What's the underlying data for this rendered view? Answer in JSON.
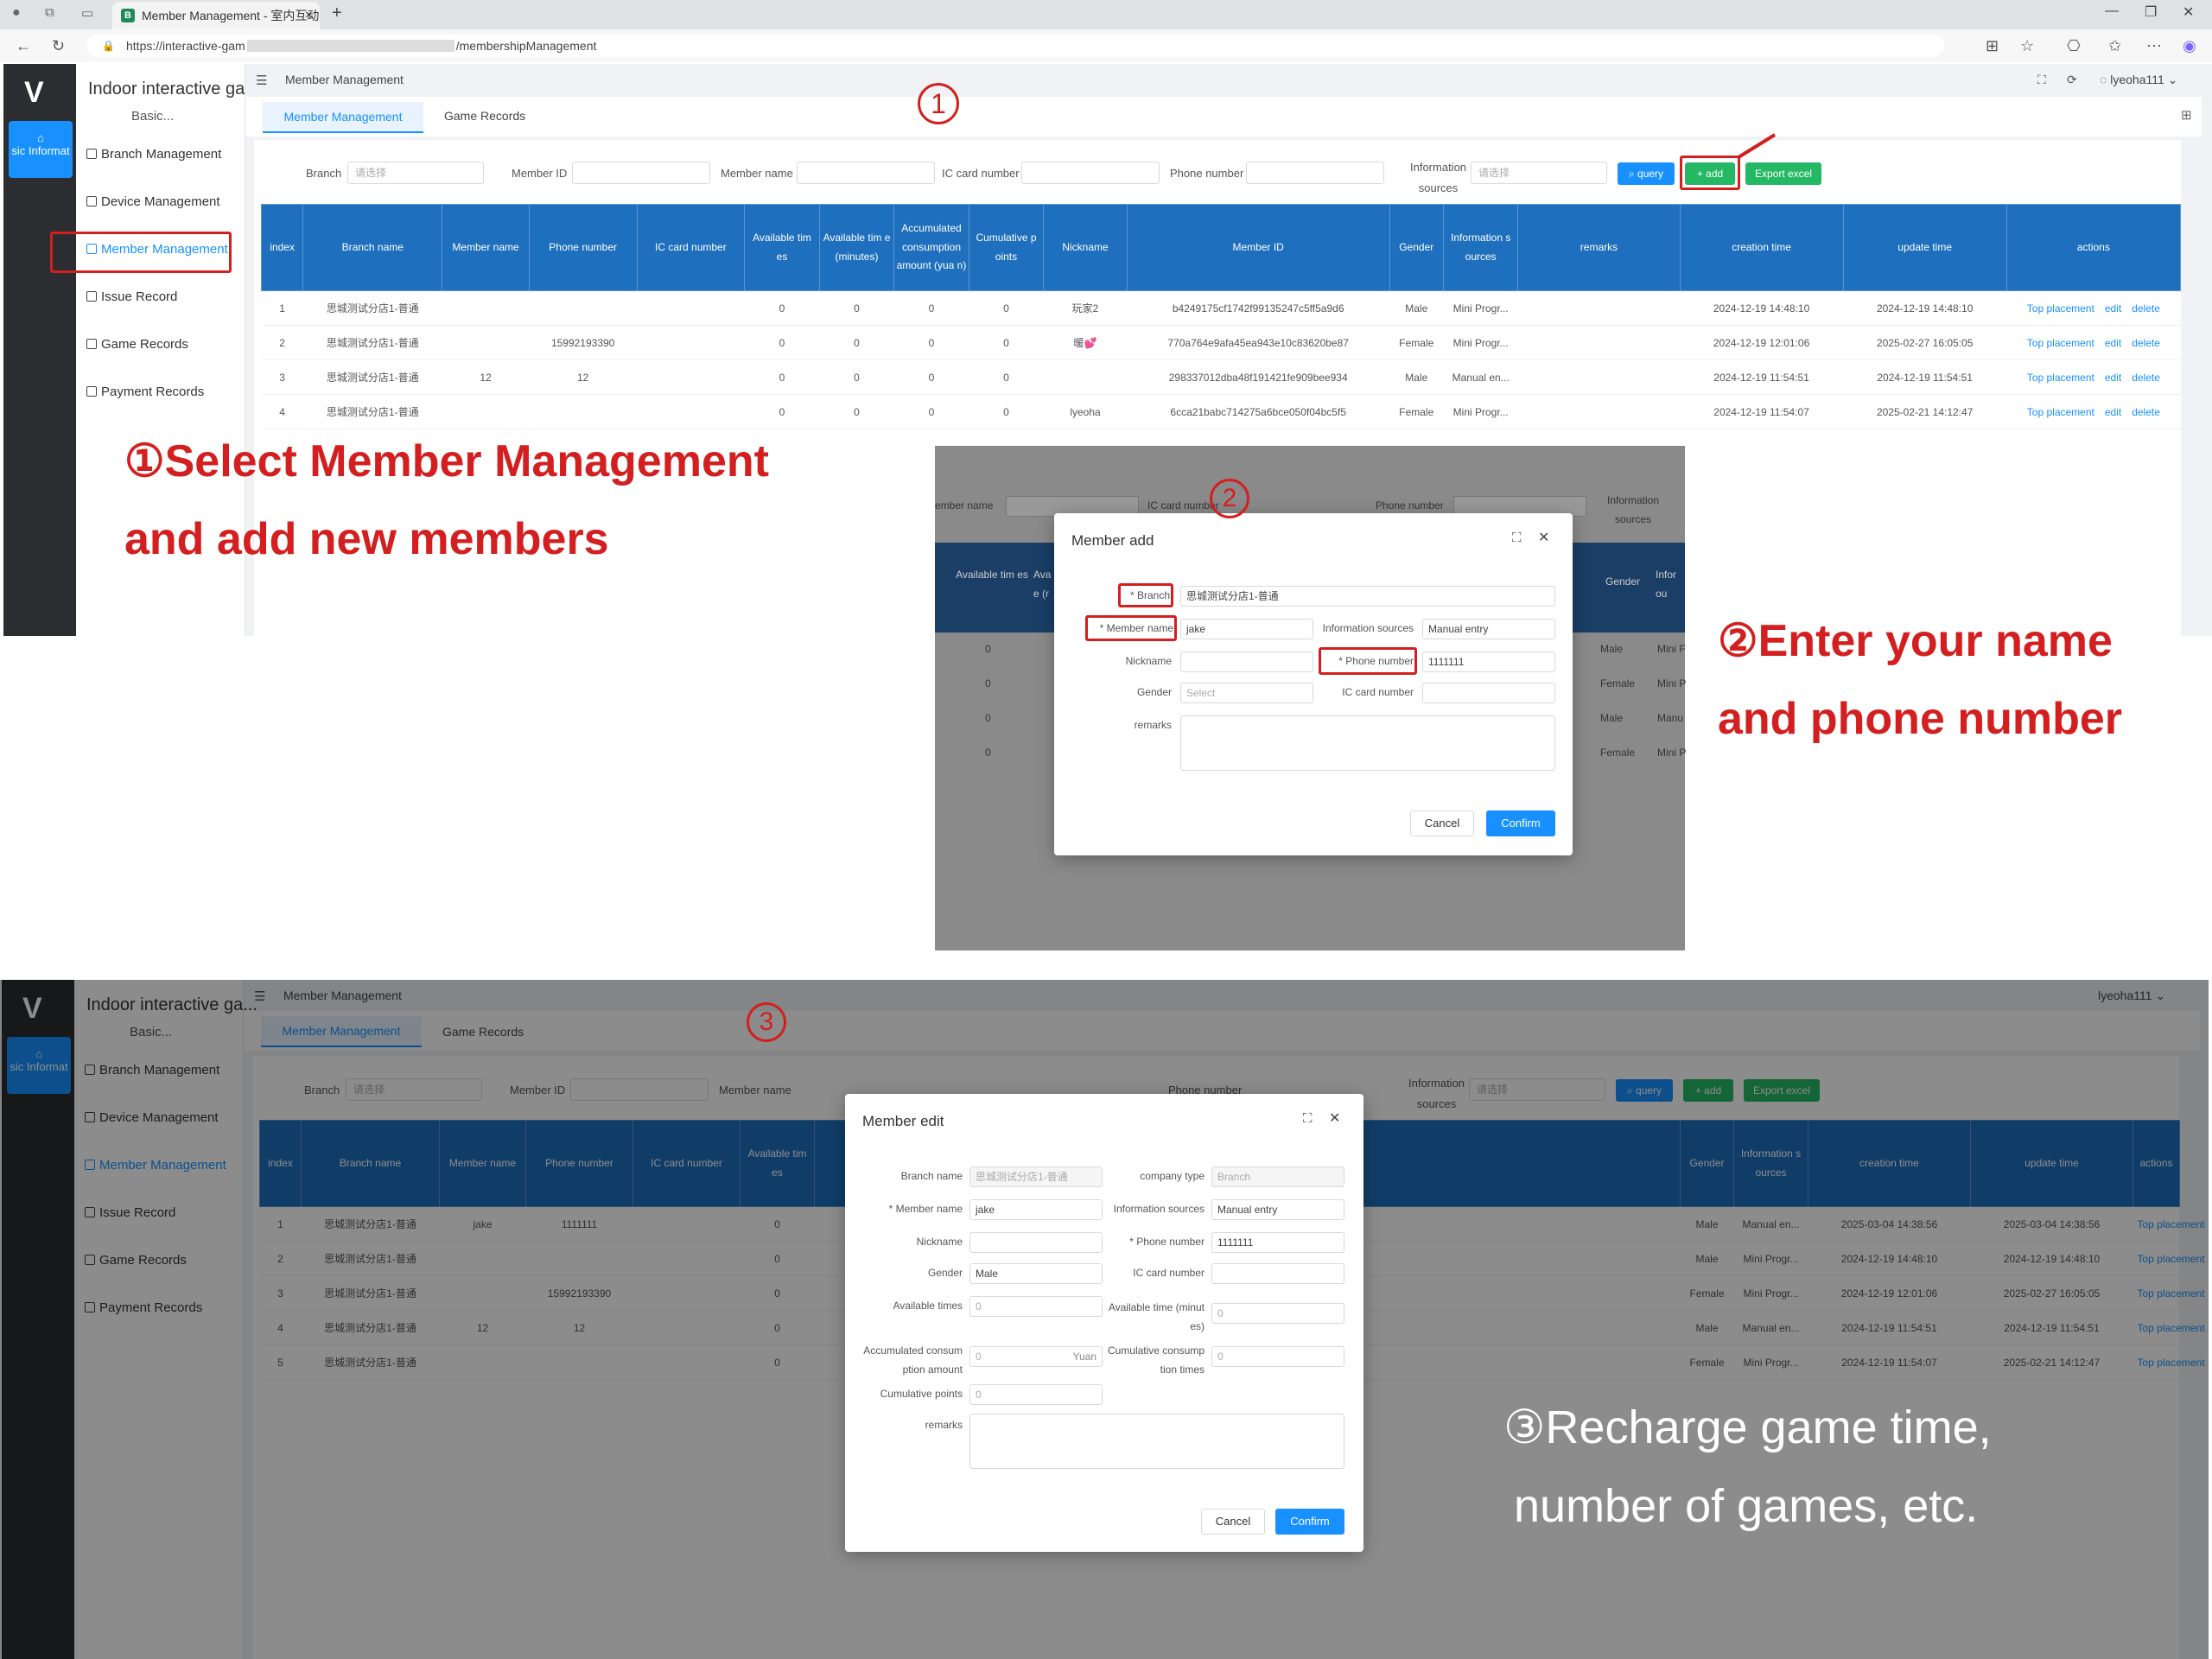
{
  "browser": {
    "tab_title": "Member Management - 室内互动",
    "tab_icon": "B",
    "url": "https://interactive-gam",
    "url_tail": "/membershipManagement"
  },
  "app": {
    "title": "Indoor interactive ga...",
    "subtitle": "Basic...",
    "home_label": "sic Informat",
    "user": "lyeoha111",
    "breadcrumb": "Member Management"
  },
  "sidebar": [
    "Branch Management",
    "Device Management",
    "Member Management",
    "Issue Record",
    "Game Records",
    "Payment Records"
  ],
  "tabs": [
    "Member Management",
    "Game Records"
  ],
  "filters": {
    "branch": "Branch",
    "branch_ph": "请选择",
    "member_id": "Member ID",
    "member_name": "Member name",
    "ic": "IC card number",
    "phone": "Phone number",
    "info1": "Information",
    "info2": "sources",
    "info_ph": "请选择",
    "query": "query",
    "add": "+ add",
    "export": "Export excel"
  },
  "table1": {
    "headers": [
      "index",
      "Branch name",
      "Member name",
      "Phone number",
      "IC card number",
      "Available tim es",
      "Available tim e (minutes)",
      "Accumulated consumption amount (yua n)",
      "Cumulative p oints",
      "Nickname",
      "Member ID",
      "Gender",
      "Information s ources",
      "remarks",
      "creation time",
      "update time",
      "actions"
    ],
    "rows": [
      [
        "1",
        "思城测试分店1-普通",
        "",
        "",
        "",
        "0",
        "0",
        "0",
        "0",
        "玩家2",
        "b4249175cf1742f99135247c5ff5a9d6",
        "Male",
        "Mini Progr...",
        "",
        "2024-12-19 14:48:10",
        "2024-12-19 14:48:10"
      ],
      [
        "2",
        "思城测试分店1-普通",
        "",
        "15992193390",
        "",
        "0",
        "0",
        "0",
        "0",
        "暖💕",
        "770a764e9afa45ea943e10c83620be87",
        "Female",
        "Mini Progr...",
        "",
        "2024-12-19 12:01:06",
        "2025-02-27 16:05:05"
      ],
      [
        "3",
        "思城测试分店1-普通",
        "12",
        "12",
        "",
        "0",
        "0",
        "0",
        "0",
        "",
        "298337012dba48f191421fe909bee934",
        "Male",
        "Manual en...",
        "",
        "2024-12-19 11:54:51",
        "2024-12-19 11:54:51"
      ],
      [
        "4",
        "思城测试分店1-普通",
        "",
        "",
        "",
        "0",
        "0",
        "0",
        "0",
        "lyeoha",
        "6cca21babc714275a6bce050f04bc5f5",
        "Female",
        "Mini Progr...",
        "",
        "2024-12-19 11:54:07",
        "2025-02-21 14:12:47"
      ]
    ]
  },
  "actions": [
    "Top placement",
    "edit",
    "delete"
  ],
  "step1": {
    "num": "①",
    "line1": "①Select Member Management",
    "line2": "and add new members"
  },
  "step2": {
    "num": "②",
    "line1": "②Enter your name",
    "line2": "and phone number"
  },
  "step3": {
    "num": "③",
    "line1": "③Recharge game time,",
    "line2": "number of games, etc."
  },
  "add_modal": {
    "title": "Member add",
    "branch_label": "* Branch",
    "branch_value": "思城测试分店1-普通",
    "member_name_label": "* Member name",
    "member_name": "jake",
    "info_label": "Information sources",
    "info_value": "Manual entry",
    "nickname_label": "Nickname",
    "phone_label": "* Phone number",
    "phone": "1111111",
    "gender_label": "Gender",
    "gender_ph": "Select",
    "ic_label": "IC card number",
    "remarks_label": "remarks",
    "cancel": "Cancel",
    "confirm": "Confirm"
  },
  "add_bg": {
    "member_name": "ember name",
    "ic": "IC card number",
    "phone": "Phone number",
    "info1": "Information",
    "info2": "sources",
    "h1": "Available tim es",
    "h2": "Ava e (r",
    "gender": "Gender",
    "info_col": "Infor ou",
    "zeros": [
      "0",
      "0",
      "0",
      "0"
    ],
    "genders": [
      "Male",
      "Female",
      "Male",
      "Female"
    ],
    "mini": [
      "Mini F",
      "Mini P",
      "Manu",
      "Mini P"
    ]
  },
  "edit_modal": {
    "title": "Member edit",
    "branch_name_label": "Branch name",
    "branch_name": "思城测试分店1-普通",
    "company_type_label": "company type",
    "company_type": "Branch",
    "member_name_label": "* Member name",
    "member_name": "jake",
    "info_label": "Information sources",
    "info_value": "Manual entry",
    "nickname_label": "Nickname",
    "phone_label": "* Phone number",
    "phone": "1111111",
    "gender_label": "Gender",
    "gender": "Male",
    "ic_label": "IC card number",
    "avail_times_label": "Available times",
    "avail_times": "0",
    "avail_min_label1": "Available time (minut",
    "avail_min_label2": "es)",
    "avail_min": "0",
    "acc_label1": "Accumulated consum",
    "acc_label2": "ption amount",
    "acc": "0",
    "acc_unit": "Yuan",
    "cum_times_label1": "Cumulative consump",
    "cum_times_label2": "tion times",
    "cum_times": "0",
    "points_label": "Cumulative points",
    "points": "0",
    "remarks_label": "remarks",
    "cancel": "Cancel",
    "confirm": "Confirm"
  },
  "table3": {
    "rows": [
      [
        "1",
        "思城测试分店1-普通",
        "jake",
        "1111111",
        "",
        "0",
        "Male",
        "Manual en...",
        "2025-03-04 14:38:56",
        "2025-03-04 14:38:56"
      ],
      [
        "2",
        "思城测试分店1-普通",
        "",
        "",
        "",
        "0",
        "Male",
        "Mini Progr...",
        "2024-12-19 14:48:10",
        "2024-12-19 14:48:10"
      ],
      [
        "3",
        "思城测试分店1-普通",
        "",
        "15992193390",
        "",
        "0",
        "Female",
        "Mini Progr...",
        "2024-12-19 12:01:06",
        "2025-02-27 16:05:05"
      ],
      [
        "4",
        "思城测试分店1-普通",
        "12",
        "12",
        "",
        "0",
        "Male",
        "Manual en...",
        "2024-12-19 11:54:51",
        "2024-12-19 11:54:51"
      ],
      [
        "5",
        "思城测试分店1-普通",
        "",
        "",
        "",
        "0",
        "Female",
        "Mini Progr...",
        "2024-12-19 11:54:07",
        "2025-02-21 14:12:47"
      ]
    ]
  }
}
